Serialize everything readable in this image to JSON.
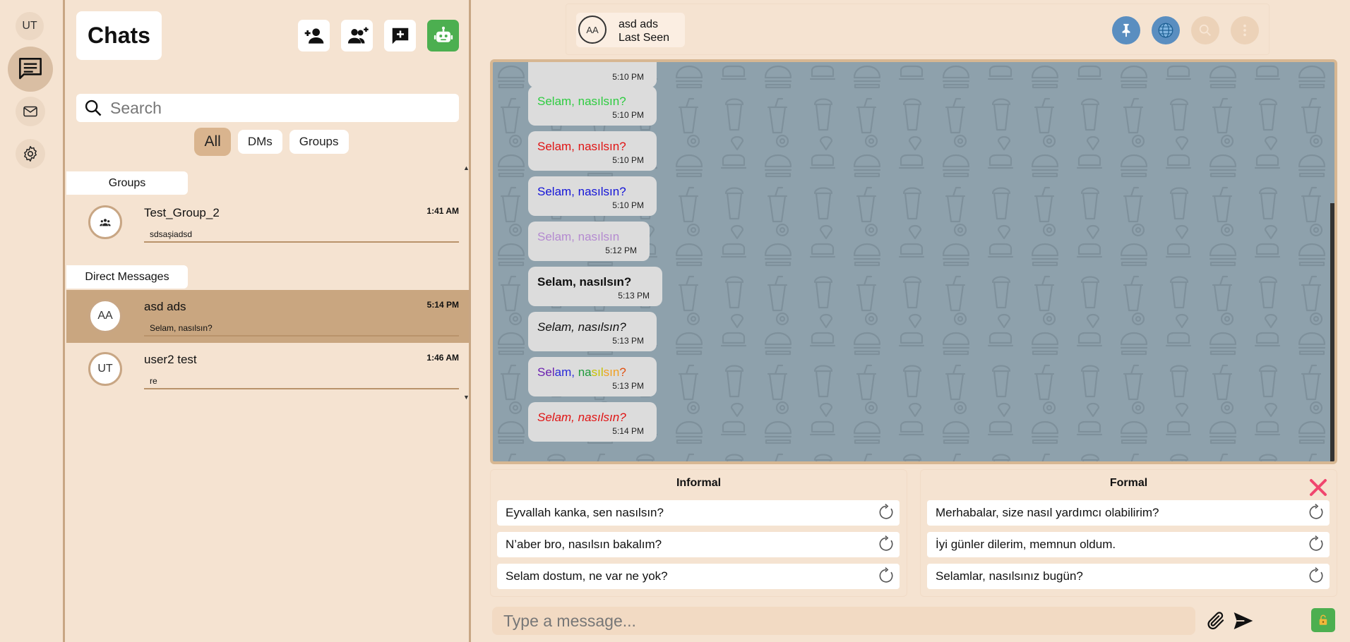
{
  "user": {
    "initials": "UT"
  },
  "chat_list": {
    "title": "Chats",
    "search_placeholder": "Search",
    "filters": [
      "All",
      "DMs",
      "Groups"
    ],
    "active_filter": "All",
    "sections": {
      "groups": "Groups",
      "direct": "Direct Messages"
    },
    "groups": [
      {
        "name": "Test_Group_2",
        "preview": "sdsaşiadsd",
        "time": "1:41 AM",
        "icon": "group-icon"
      }
    ],
    "direct": [
      {
        "initials": "AA",
        "name": "asd ads",
        "preview": "Selam, nasılsın?",
        "time": "5:14 PM",
        "active": true
      },
      {
        "initials": "UT",
        "name": "user2 test",
        "preview": "re",
        "time": "1:46 AM",
        "active": false
      }
    ]
  },
  "header": {
    "initials": "AA",
    "name": "asd ads",
    "status": "Last Seen"
  },
  "messages": [
    {
      "text": "",
      "time": "5:10 PM",
      "color": "#000000",
      "style": "normal"
    },
    {
      "text": "Selam, nasılsın?",
      "time": "5:10 PM",
      "color": "#2ecc40",
      "style": "normal"
    },
    {
      "text": "Selam, nasılsın?",
      "time": "5:10 PM",
      "color": "#e01414",
      "style": "normal"
    },
    {
      "text": "Selam, nasılsın?",
      "time": "5:10 PM",
      "color": "#1414d8",
      "style": "normal"
    },
    {
      "text": "Selam, nasılsın",
      "time": "5:12 PM",
      "color": "#b48ad0",
      "style": "normal"
    },
    {
      "text": "Selam, nasılsın?",
      "time": "5:13 PM",
      "color": "#111111",
      "style": "bold"
    },
    {
      "text": "Selam, nasılsın?",
      "time": "5:13 PM",
      "color": "#111111",
      "style": "italic"
    },
    {
      "text": "Selam, nasılsın?",
      "time": "5:13 PM",
      "color": "rainbow",
      "style": "normal"
    },
    {
      "text": "Selam, nasılsın?",
      "time": "5:14 PM",
      "color": "#e01414",
      "style": "italic"
    }
  ],
  "suggestions": {
    "informal": {
      "title": "Informal",
      "items": [
        "Eyvallah kanka, sen nasılsın?",
        "N’aber bro, nasılsın bakalım?",
        "Selam dostum, ne var ne yok?"
      ]
    },
    "formal": {
      "title": "Formal",
      "items": [
        "Merhabalar, size nasıl yardımcı olabilirim?",
        "İyi günler dilerim, memnun oldum.",
        "Selamlar, nasılsınız bugün?"
      ]
    }
  },
  "composer": {
    "placeholder": "Type a message..."
  },
  "colors": {
    "accent_green": "#4caf50",
    "background": "#f5e3d1",
    "chat_bg": "#8ea1ac",
    "pin_blue": "#5a8ec0"
  }
}
